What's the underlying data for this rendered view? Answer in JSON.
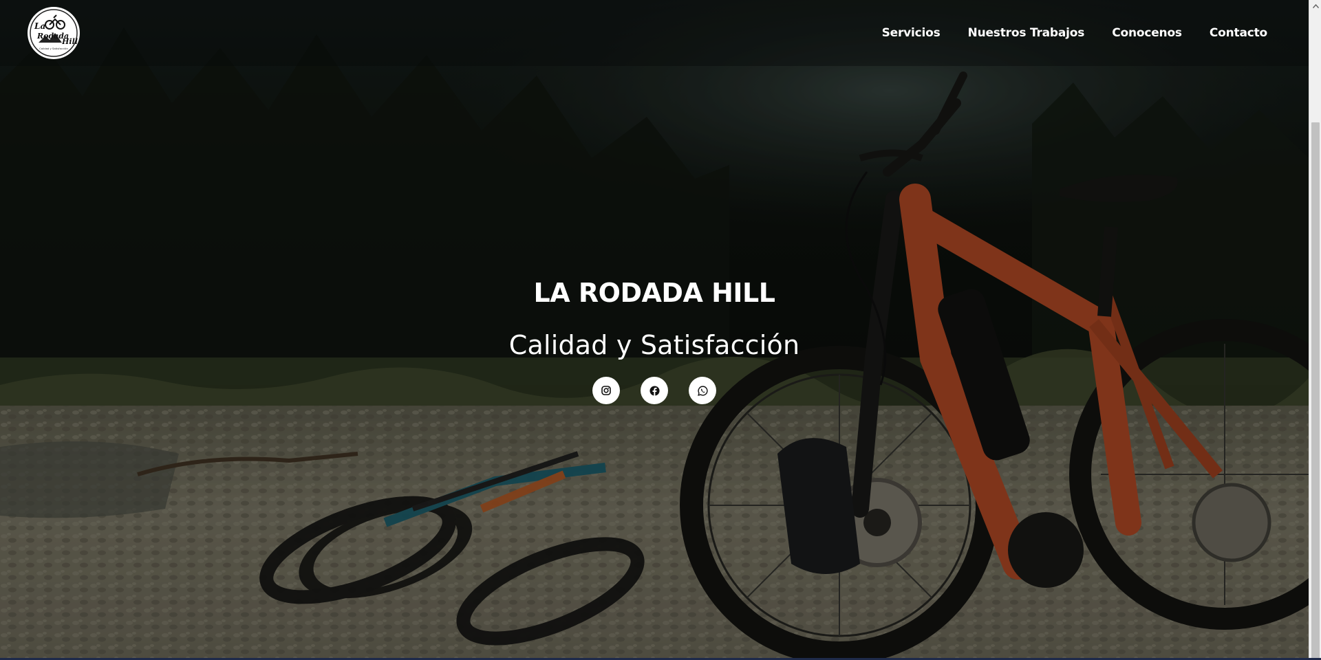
{
  "brand": {
    "logo_line1": "La",
    "logo_line2": "Rodada",
    "logo_line3": "Hill",
    "logo_tagline": "Calidad y Satisfacción"
  },
  "nav": {
    "items": [
      {
        "label": "Servicios"
      },
      {
        "label": "Nuestros Trabajos"
      },
      {
        "label": "Conocenos"
      },
      {
        "label": "Contacto"
      }
    ]
  },
  "hero": {
    "title": "LA RODADA HILL",
    "subtitle": "Calidad y Satisfacción"
  },
  "social": [
    {
      "icon": "instagram-icon"
    },
    {
      "icon": "facebook-icon"
    },
    {
      "icon": "whatsapp-icon"
    }
  ],
  "colors": {
    "nav_bg": "#0a0c0b",
    "text": "#ffffff",
    "bike_orange": "#c8532a",
    "scrollbar_thumb": "#c1c1c1"
  }
}
